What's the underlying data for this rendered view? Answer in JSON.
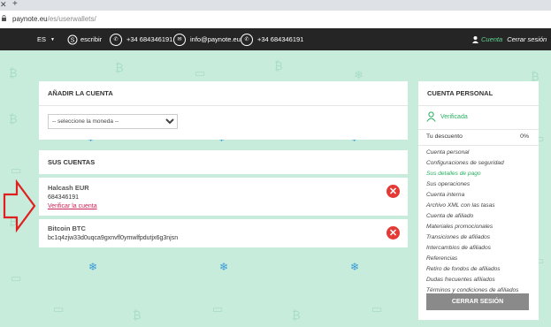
{
  "browser": {
    "close_glyph": "✕",
    "new_tab_glyph": "+",
    "url_domain": "paynote.eu",
    "url_path": "/es/userwallets/"
  },
  "topbar": {
    "language": "ES",
    "write_label": "escribir",
    "whatsapp_phone": "+34 684346191",
    "email": "info@paynote.eu",
    "phone": "+34 684346191",
    "account_label": "Cuenta",
    "logout_label": "Cerrar sesión",
    "accent_color": "#5fd490"
  },
  "add_account": {
    "title": "AÑADIR LA CUENTA",
    "select_value": "-- seleccione la moneda --"
  },
  "accounts": {
    "title": "SUS CUENTAS",
    "items": [
      {
        "name": "Halcash EUR",
        "detail": "684346191",
        "link": "Verificar la cuenta"
      },
      {
        "name": "Bitcoin BTC",
        "detail": "bc1q4zjw33d0uqca9gxnvfl0ymwlfpdutjx6g3njsn"
      }
    ]
  },
  "sidebar": {
    "title": "CUENTA PERSONAL",
    "status": "Verificada",
    "discount_label": "Tu descuento",
    "discount_value": "0%",
    "links": [
      "Cuenta personal",
      "Configuraciones de seguridad",
      "Sus detalles de pago",
      "Sus operaciones",
      "Cuenta interna",
      "Archivo XML con las tasas",
      "Cuenta de afiliado",
      "Materiales promocionales",
      "Transiciones de afiliados",
      "Intercambios de afiliados",
      "Referencias",
      "Retiro de fondos de afiliados",
      "Dudas frecuentes afiliados",
      "Términos y condiciones de afiliados"
    ],
    "active_index": 2,
    "logout_button": "CERRAR SESIÓN"
  },
  "colors": {
    "background": "#c7ecdc",
    "delete_red": "#e53935",
    "annotation_arrow": "#e02020",
    "link_pink": "#cc2255",
    "verified_green": "#27ae60"
  }
}
